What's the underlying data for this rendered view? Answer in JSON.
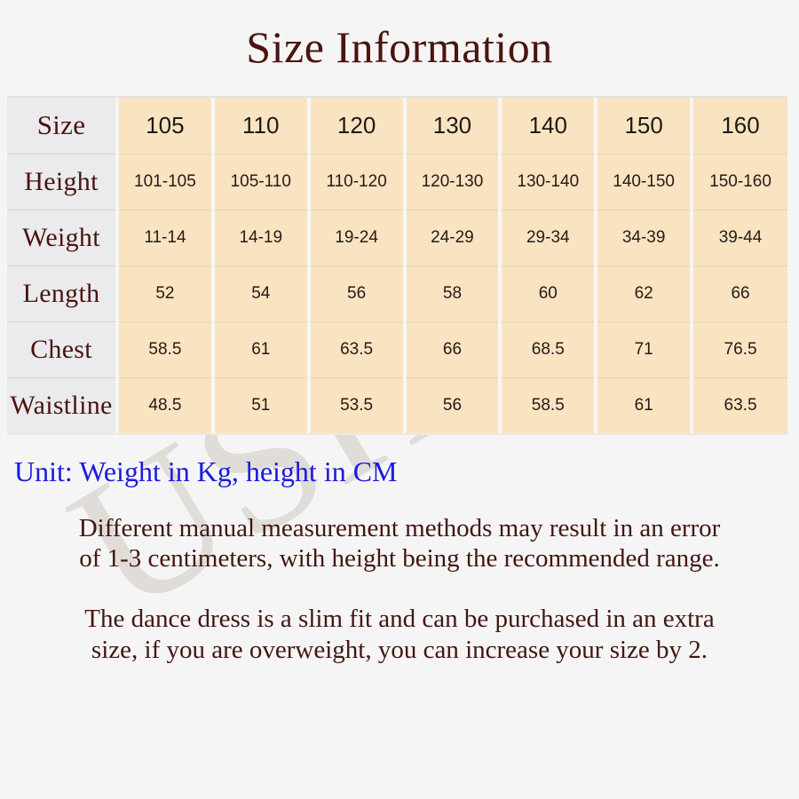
{
  "title": "Size Information",
  "watermark": "USHINE",
  "colors": {
    "title": "#4A1410",
    "cell_fill": "#FAE3C0",
    "label_fill": "#EBEBED",
    "unit_text": "#1A1AE0",
    "note_text": "#431611",
    "page_background": "#F5F5F5",
    "watermark": "#D9D6CF"
  },
  "chart_data": {
    "type": "table",
    "title": "Size Information",
    "columns": [
      "Size",
      "105",
      "110",
      "120",
      "130",
      "140",
      "150",
      "160"
    ],
    "rows": [
      {
        "label": "Size",
        "values": [
          "105",
          "110",
          "120",
          "130",
          "140",
          "150",
          "160"
        ]
      },
      {
        "label": "Height",
        "values": [
          "101-105",
          "105-110",
          "110-120",
          "120-130",
          "130-140",
          "140-150",
          "150-160"
        ]
      },
      {
        "label": "Weight",
        "values": [
          "11-14",
          "14-19",
          "19-24",
          "24-29",
          "29-34",
          "34-39",
          "39-44"
        ]
      },
      {
        "label": "Length",
        "values": [
          "52",
          "54",
          "56",
          "58",
          "60",
          "62",
          "66"
        ]
      },
      {
        "label": "Chest",
        "values": [
          "58.5",
          "61",
          "63.5",
          "66",
          "68.5",
          "71",
          "76.5"
        ]
      },
      {
        "label": "Waistline",
        "values": [
          "48.5",
          "51",
          "53.5",
          "56",
          "58.5",
          "61",
          "63.5"
        ]
      }
    ],
    "units": {
      "weight": "Kg",
      "height": "CM"
    }
  },
  "unit_note": "Unit: Weight in Kg, height in CM",
  "notes": [
    "Different manual measurement methods may result in an error",
    "of 1-3 centimeters, with height being the recommended range.",
    "The dance dress is a slim fit and can be purchased in an extra",
    "size,  if you are overweight, you can increase your size by 2."
  ]
}
